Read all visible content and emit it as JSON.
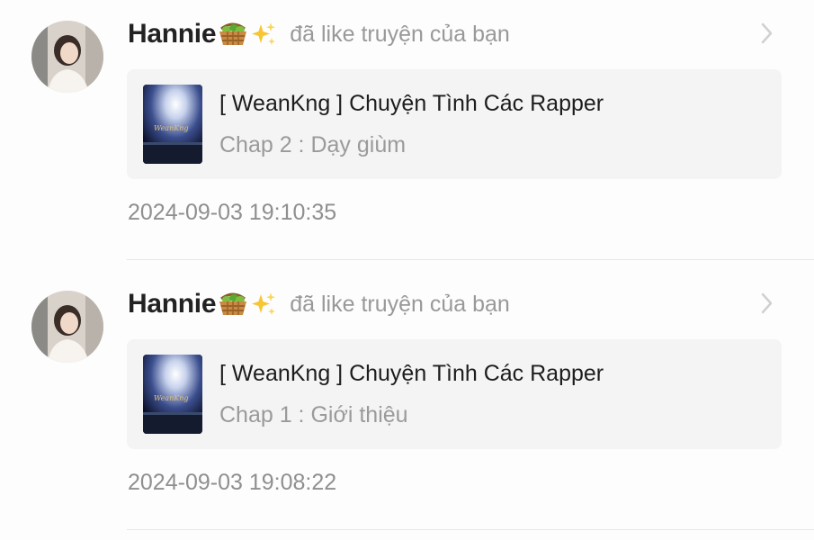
{
  "notifications": [
    {
      "user": "Hannie",
      "emoji": [
        "basket-emoji",
        "sparkles-emoji"
      ],
      "action_text": "đã like truyện của bạn",
      "story_title": "[ WeanKng ] Chuyện Tình Các Rapper",
      "chapter": "Chap 2 : Dạy giùm",
      "cover_text": "WeanKng",
      "timestamp": "2024-09-03 19:10:35"
    },
    {
      "user": "Hannie",
      "emoji": [
        "basket-emoji",
        "sparkles-emoji"
      ],
      "action_text": "đã like truyện của bạn",
      "story_title": "[ WeanKng ] Chuyện Tình Các Rapper",
      "chapter": "Chap 1 : Giới thiệu",
      "cover_text": "WeanKng",
      "timestamp": "2024-09-03 19:08:22"
    }
  ],
  "colors": {
    "background": "#fdfdfd",
    "card_background": "#f4f4f4",
    "username": "#222222",
    "muted_text": "#999999",
    "divider": "#e6e6e6"
  }
}
